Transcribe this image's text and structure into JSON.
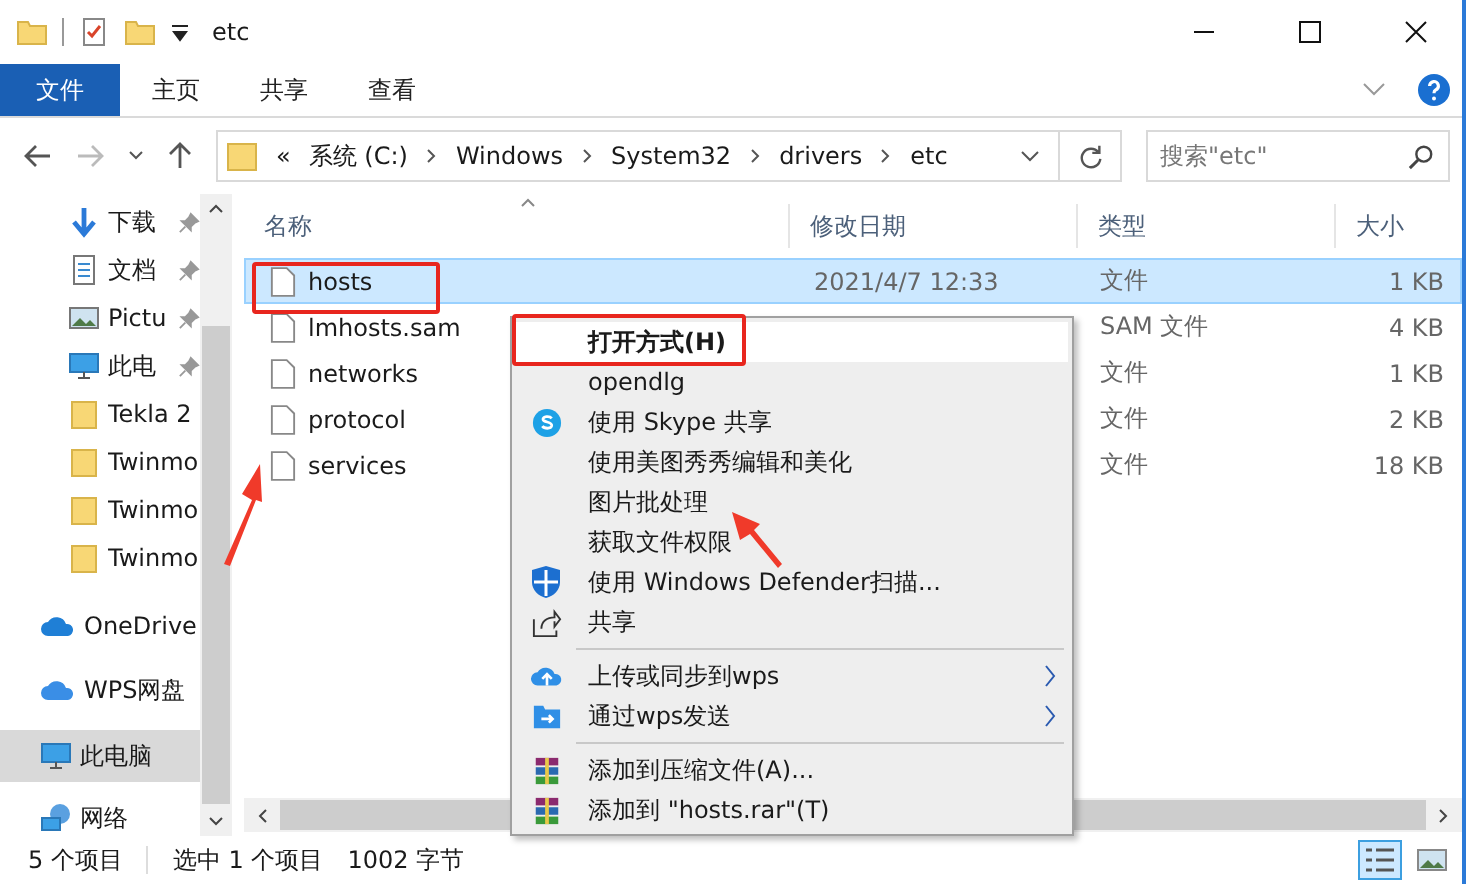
{
  "window": {
    "title": "etc"
  },
  "ribbon_tabs": [
    {
      "label": "文件",
      "selected": true
    },
    {
      "label": "主页",
      "selected": false
    },
    {
      "label": "共享",
      "selected": false
    },
    {
      "label": "查看",
      "selected": false
    }
  ],
  "address": {
    "overflow": "«",
    "crumbs": [
      "系统 (C:)",
      "Windows",
      "System32",
      "drivers",
      "etc"
    ]
  },
  "search": {
    "placeholder": "搜索\"etc\""
  },
  "sidebar": {
    "items": [
      {
        "label": "下载",
        "kind": "download",
        "pinned": true,
        "selected": false
      },
      {
        "label": "文档",
        "kind": "document",
        "pinned": true,
        "selected": false
      },
      {
        "label": "Pictu",
        "kind": "picture",
        "pinned": true,
        "selected": false
      },
      {
        "label": "此电",
        "kind": "pc",
        "pinned": true,
        "selected": false
      },
      {
        "label": "Tekla 2",
        "kind": "folder",
        "pinned": false,
        "selected": false
      },
      {
        "label": "Twinmo",
        "kind": "folder",
        "pinned": false,
        "selected": false
      },
      {
        "label": "Twinmo",
        "kind": "folder",
        "pinned": false,
        "selected": false
      },
      {
        "label": "Twinmo",
        "kind": "folder",
        "pinned": false,
        "selected": false
      },
      {
        "label": "OneDrive",
        "kind": "cloud",
        "pinned": false,
        "selected": false
      },
      {
        "label": "WPS网盘",
        "kind": "wps",
        "pinned": false,
        "selected": false
      },
      {
        "label": "此电脑",
        "kind": "pc",
        "pinned": false,
        "selected": true
      },
      {
        "label": "网络",
        "kind": "network",
        "pinned": false,
        "selected": false
      }
    ]
  },
  "table": {
    "columns": [
      "名称",
      "修改日期",
      "类型",
      "大小"
    ],
    "rows": [
      {
        "name": "hosts",
        "date": "2021/4/7 12:33",
        "type": "文件",
        "size": "1 KB",
        "selected": true
      },
      {
        "name": "lmhosts.sam",
        "type": "SAM 文件",
        "size": "4 KB",
        "selected": false
      },
      {
        "name": "networks",
        "type": "文件",
        "size": "1 KB",
        "selected": false
      },
      {
        "name": "protocol",
        "type": "文件",
        "size": "2 KB",
        "selected": false
      },
      {
        "name": "services",
        "type": "文件",
        "size": "18 KB",
        "selected": false
      }
    ]
  },
  "context_menu": [
    {
      "kind": "plain",
      "label": "打开方式(H)",
      "highlighted": true,
      "submenu": false
    },
    {
      "kind": "plain",
      "label": "opendlg",
      "highlighted": false,
      "submenu": false
    },
    {
      "kind": "skype",
      "label": "使用 Skype 共享",
      "highlighted": false,
      "submenu": false
    },
    {
      "kind": "plain",
      "label": "使用美图秀秀编辑和美化",
      "highlighted": false,
      "submenu": false
    },
    {
      "kind": "plain",
      "label": "图片批处理",
      "highlighted": false,
      "submenu": false
    },
    {
      "kind": "plain",
      "label": "获取文件权限",
      "highlighted": false,
      "submenu": false
    },
    {
      "kind": "shield",
      "label": "使用 Windows Defender扫描...",
      "highlighted": false,
      "submenu": false
    },
    {
      "kind": "share",
      "label": "共享",
      "highlighted": false,
      "submenu": false
    },
    {
      "kind": "separator"
    },
    {
      "kind": "upload",
      "label": "上传或同步到wps",
      "highlighted": false,
      "submenu": true
    },
    {
      "kind": "send",
      "label": "通过wps发送",
      "highlighted": false,
      "submenu": true
    },
    {
      "kind": "separator"
    },
    {
      "kind": "archive",
      "label": "添加到压缩文件(A)...",
      "highlighted": false,
      "submenu": false
    },
    {
      "kind": "archive",
      "label": "添加到 \"hosts.rar\"(T)",
      "highlighted": false,
      "submenu": false
    }
  ],
  "status_bar": {
    "count": "5 个项目",
    "selection": "选中 1 个项目",
    "size": "1002 字节"
  },
  "view_buttons": [
    {
      "kind": "details",
      "selected": true
    },
    {
      "kind": "large-icons",
      "selected": false
    }
  ]
}
